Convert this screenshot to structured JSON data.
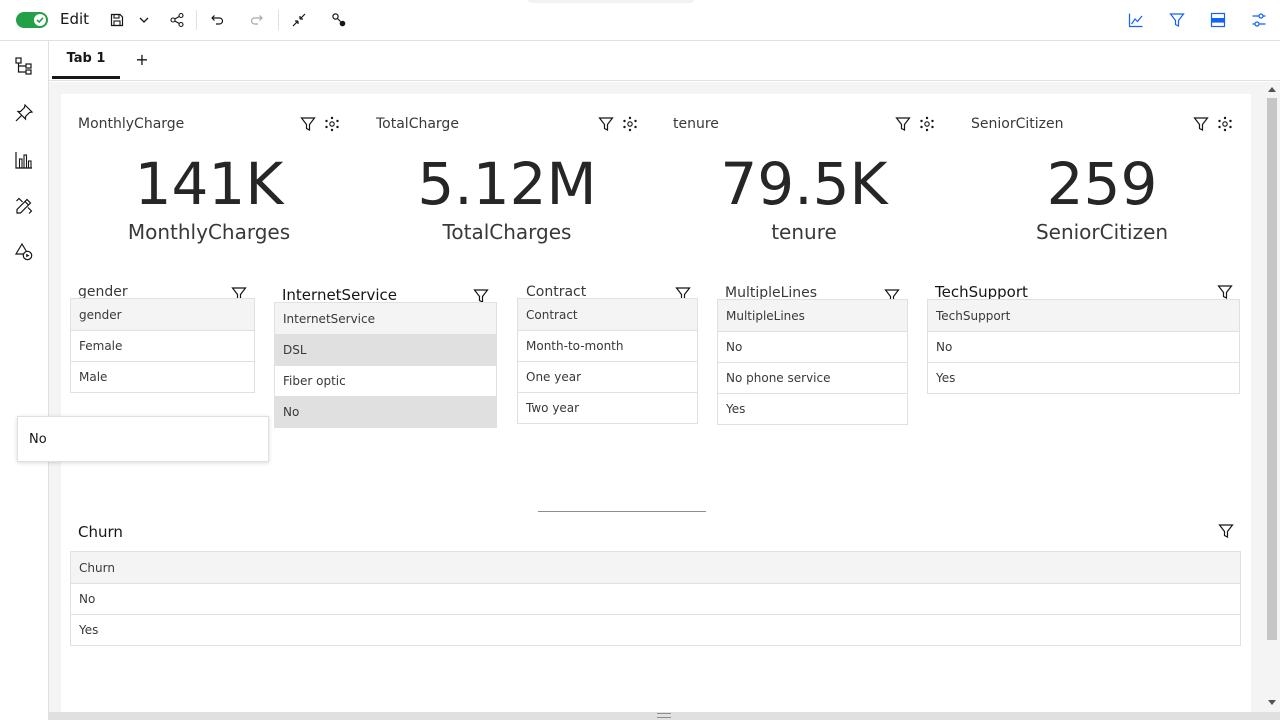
{
  "toolbar": {
    "mode_label": "Edit",
    "mode_on": true,
    "accent": "#24a148",
    "brand": "#0f62fe",
    "left_icons": [
      "save-icon",
      "chevron-down-icon",
      "share-icon",
      "undo-icon",
      "redo-icon",
      "collapse-icon",
      "connect-icon"
    ],
    "right_icons": [
      "chart-line-icon",
      "filter-icon",
      "data-panel-icon",
      "settings-sliders-icon"
    ]
  },
  "sidebar": {
    "icons": [
      "tree-icon",
      "pin-icon",
      "bar-chart-icon",
      "edit-tools-icon",
      "shapes-icon"
    ]
  },
  "tabs": {
    "items": [
      {
        "label": "Tab 1",
        "active": true
      }
    ],
    "add_label": "+"
  },
  "kpis": [
    {
      "title": "MonthlyCharge",
      "value": "141K",
      "label": "MonthlyCharges"
    },
    {
      "title": "TotalCharge",
      "value": "5.12M",
      "label": "TotalCharges"
    },
    {
      "title": "tenure",
      "value": "79.5K",
      "label": "tenure"
    },
    {
      "title": "SeniorCitizen",
      "value": "259",
      "label": "SeniorCitizen"
    }
  ],
  "lists": {
    "gender": {
      "title": "gender",
      "header": "gender",
      "rows": [
        "Female",
        "Male"
      ]
    },
    "internet": {
      "title": "InternetService",
      "header": "InternetService",
      "rows": [
        "DSL",
        "Fiber optic",
        "No"
      ],
      "selected": [
        "DSL",
        "No"
      ]
    },
    "contract": {
      "title": "Contract",
      "header": "Contract",
      "rows": [
        "Month-to-month",
        "One year",
        "Two year"
      ]
    },
    "multiple": {
      "title": "MultipleLines",
      "header": "MultipleLines",
      "rows": [
        "No",
        "No phone service",
        "Yes"
      ]
    },
    "tech": {
      "title": "TechSupport",
      "header": "TechSupport",
      "rows": [
        "No",
        "Yes"
      ]
    },
    "churn": {
      "title": "Churn",
      "header": "Churn",
      "rows": [
        "No",
        "Yes"
      ]
    }
  },
  "popup": {
    "text": "No"
  }
}
